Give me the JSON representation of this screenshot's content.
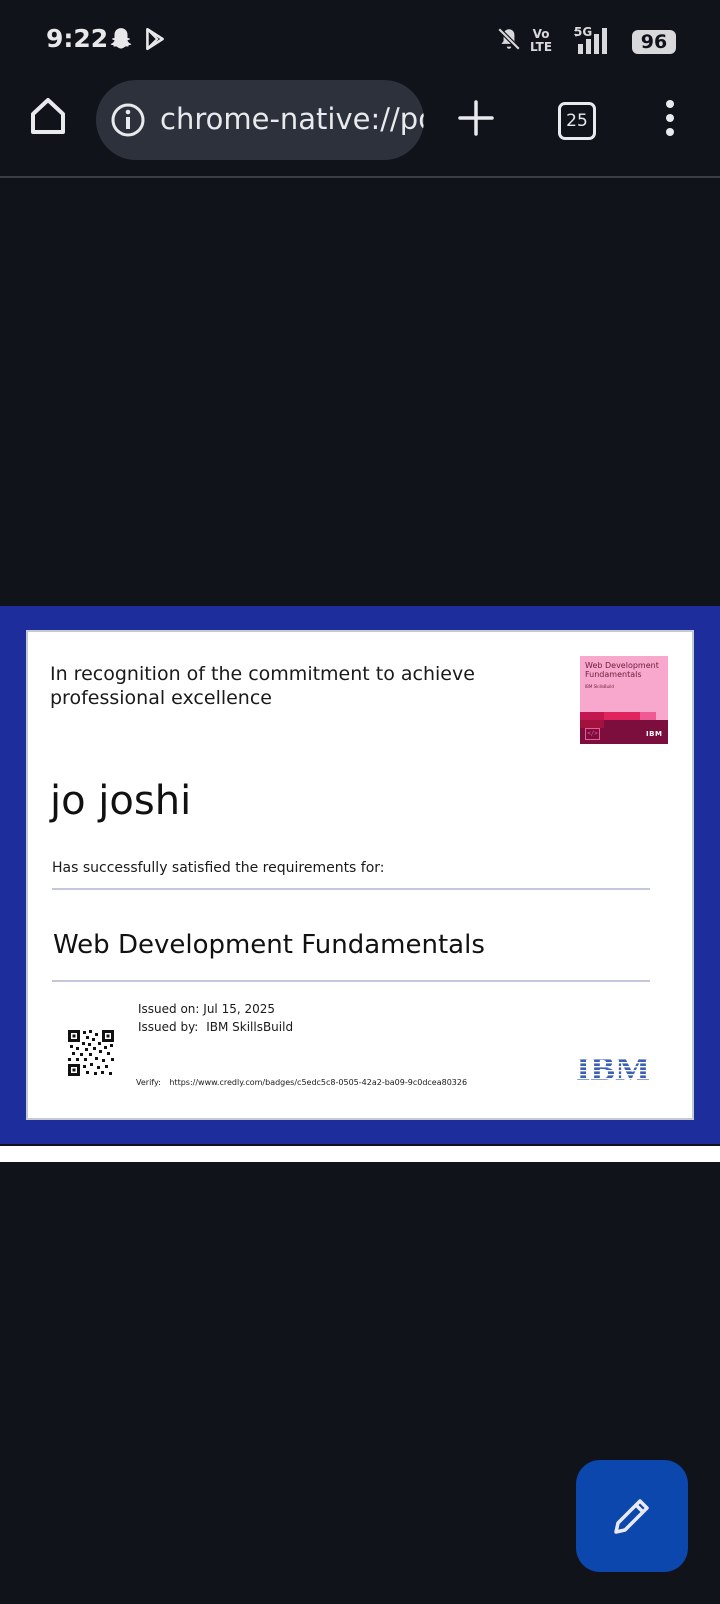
{
  "status_bar": {
    "time": "9:22",
    "icons": [
      "snapchat-icon",
      "play-store-icon",
      "bell-muted-icon",
      "signal-icon"
    ],
    "volte_top": "Vo",
    "volte_bottom": "LTE",
    "network": "5G",
    "battery": "96"
  },
  "toolbar": {
    "url": "chrome-native://pd",
    "tab_count": "25",
    "icons": [
      "home-icon",
      "info-icon",
      "plus-icon",
      "more-vert-icon"
    ]
  },
  "certificate": {
    "recognition_line1": "In recognition of the commitment to achieve",
    "recognition_line2": "professional excellence",
    "badge": {
      "title_line1": "Web Development",
      "title_line2": "Fundamentals",
      "subtitle": "IBM SkillsBuild",
      "logo": "IBM"
    },
    "recipient": "jo joshi",
    "satisfied": "Has successfully satisfied the requirements for:",
    "course": "Web Development Fundamentals",
    "issued_on_label": "Issued on:",
    "issued_on": "Jul 15, 2025",
    "issued_by_label": "Issued by:",
    "issued_by": "IBM SkillsBuild",
    "verify_label": "Verify:",
    "verify_url": "https://www.credly.com/badges/c5edc5c8-0505-42a2-ba09-9c0dcea80326",
    "logo": "IBM"
  },
  "fab": {
    "icon": "edit-pencil-icon"
  },
  "colors": {
    "background": "#11131b",
    "page_border": "#1e2d9c",
    "fab": "#0b47ad",
    "ibm_logo": "#3b5fb5"
  }
}
